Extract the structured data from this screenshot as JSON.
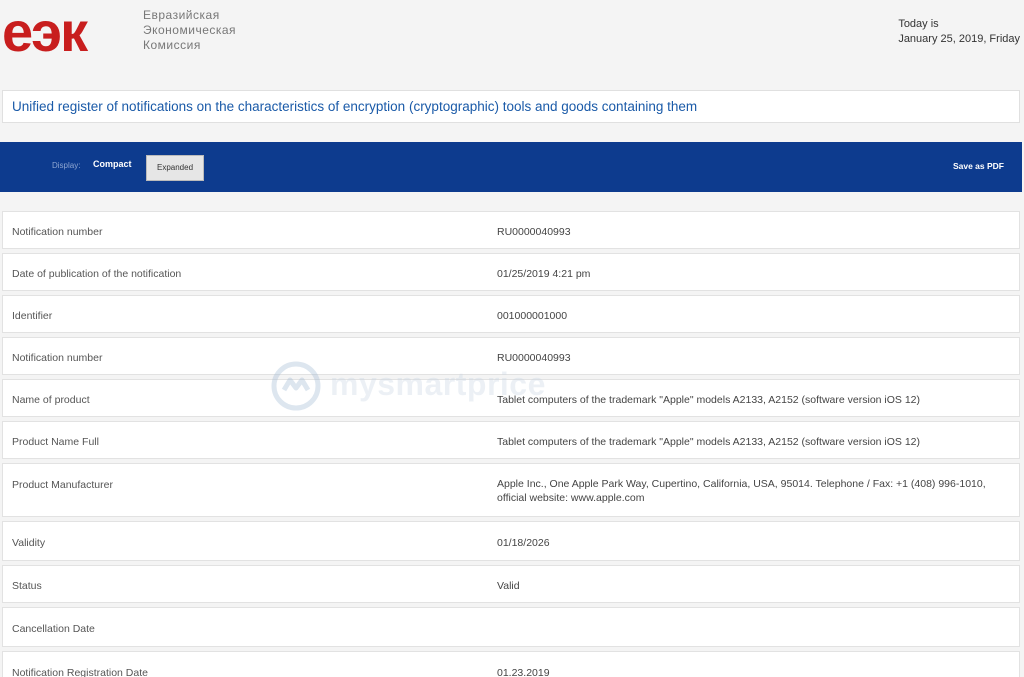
{
  "header": {
    "logo": "еэк",
    "org_name": [
      "Евразийская",
      "Экономическая",
      "Комиссия"
    ],
    "today_label": "Today is",
    "today_date": "January 25, 2019, Friday"
  },
  "title": "Unified register of notifications on the characteristics of encryption (cryptographic) tools and goods containing them",
  "toolbar": {
    "display_label": "Display:",
    "compact_label": "Compact",
    "expanded_label": "Expanded",
    "save_pdf_label": "Save as PDF"
  },
  "rows": [
    {
      "label": "Notification number",
      "value": "RU0000040993"
    },
    {
      "label": "Date of publication of the notification",
      "value": "01/25/2019 4:21 pm"
    },
    {
      "label": "Identifier",
      "value": "001000001000"
    },
    {
      "label": "Notification number",
      "value": "RU0000040993"
    },
    {
      "label": "Name of product",
      "value": "Tablet computers of the trademark \"Apple\" models A2133, A2152 (software version iOS 12)"
    },
    {
      "label": "Product Name Full",
      "value": "Tablet computers of the trademark \"Apple\" models A2133, A2152 (software version iOS 12)"
    },
    {
      "label": "Product Manufacturer",
      "value": "Apple Inc., One Apple Park Way, Cupertino, California, USA, 95014. Telephone / Fax: +1 (408) 996-1010, official website: www.apple.com"
    },
    {
      "label": "Validity",
      "value": "01/18/2026"
    },
    {
      "label": "Status",
      "value": "Valid"
    },
    {
      "label": "Cancellation Date",
      "value": ""
    },
    {
      "label": "Notification Registration Date",
      "value": "01.23.2019"
    }
  ],
  "watermark": "mysmartprice",
  "colors": {
    "logo_red": "#c81e1e",
    "toolbar_blue": "#0d3b8e",
    "title_blue": "#1a5aa8"
  }
}
